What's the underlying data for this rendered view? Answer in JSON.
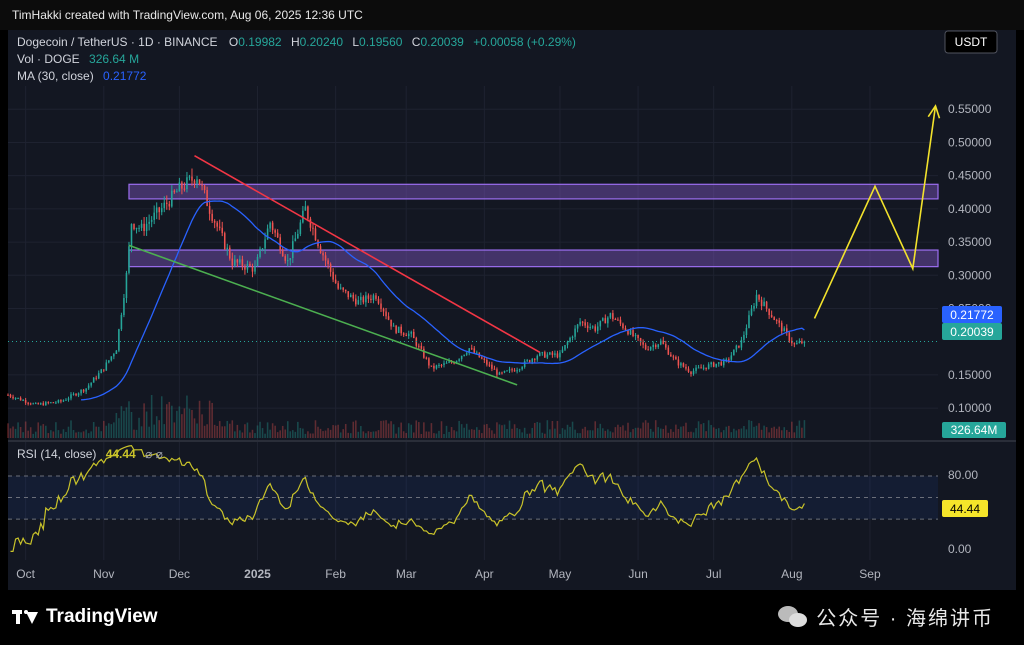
{
  "header": {
    "credit": "TimHakki created with TradingView.com, Aug 06, 2025 12:36 UTC"
  },
  "legend": {
    "symbol": "Dogecoin / TetherUS · 1D · BINANCE",
    "o_label": "O",
    "o": "0.19982",
    "h_label": "H",
    "h": "0.20240",
    "l_label": "L",
    "l": "0.19560",
    "c_label": "C",
    "c": "0.20039",
    "change": "+0.00058 (+0.29%)",
    "vol_label": "Vol · DOGE",
    "vol": "326.64 M",
    "ma_label": "MA (30, close)",
    "ma": "0.21772"
  },
  "currency_button": "USDT",
  "price_badges": {
    "ma": "0.21772",
    "last": "0.20039",
    "volume": "326.64M",
    "rsi": "44.44"
  },
  "rsi": {
    "label": "RSI (14, close)",
    "value": "44.44",
    "icons": "⌀ ⌀",
    "ticks": [
      "80.00",
      "0.00"
    ]
  },
  "footer": {
    "brand": "TradingView",
    "watermark": "公众号 · 海绵讲币"
  },
  "colors": {
    "up": "#26a69a",
    "down": "#ef5350",
    "ma": "#2962ff",
    "rsi": "#c9c32a",
    "zone": "#7e57c2",
    "projection": "#f2e22c",
    "resistance": "#f23645",
    "support": "#4caf50"
  },
  "chart_data": {
    "type": "candlestick",
    "title": "Dogecoin / TetherUS · 1D · BINANCE",
    "y_ticks": [
      "0.55000",
      "0.50000",
      "0.45000",
      "0.40000",
      "0.35000",
      "0.30000",
      "0.25000",
      "0.15000",
      "0.10000"
    ],
    "y_tick_values": [
      0.55,
      0.5,
      0.45,
      0.4,
      0.35,
      0.3,
      0.25,
      0.15,
      0.1
    ],
    "ylim": [
      0.055,
      0.585
    ],
    "x_ticks": [
      "Oct",
      "Nov",
      "Dec",
      "2025",
      "Feb",
      "Mar",
      "Apr",
      "May",
      "Jun",
      "Jul",
      "Aug",
      "Sep"
    ],
    "x_tick_dates": [
      "2024-10-01",
      "2024-11-01",
      "2024-12-01",
      "2025-01-01",
      "2025-02-01",
      "2025-03-01",
      "2025-04-01",
      "2025-05-01",
      "2025-06-01",
      "2025-07-01",
      "2025-08-01",
      "2025-09-01"
    ],
    "xlim": [
      "2024-09-24",
      "2025-09-28"
    ],
    "price_anchors": [
      [
        "2024-09-24",
        0.12
      ],
      [
        "2024-10-05",
        0.105
      ],
      [
        "2024-10-15",
        0.11
      ],
      [
        "2024-10-25",
        0.13
      ],
      [
        "2024-11-01",
        0.16
      ],
      [
        "2024-11-06",
        0.19
      ],
      [
        "2024-11-10",
        0.3
      ],
      [
        "2024-11-12",
        0.38
      ],
      [
        "2024-11-16",
        0.37
      ],
      [
        "2024-11-24",
        0.4
      ],
      [
        "2024-12-01",
        0.43
      ],
      [
        "2024-12-08",
        0.45
      ],
      [
        "2024-12-13",
        0.4
      ],
      [
        "2024-12-22",
        0.32
      ],
      [
        "2024-12-31",
        0.31
      ],
      [
        "2025-01-06",
        0.38
      ],
      [
        "2025-01-13",
        0.32
      ],
      [
        "2025-01-20",
        0.4
      ],
      [
        "2025-01-26",
        0.34
      ],
      [
        "2025-02-02",
        0.28
      ],
      [
        "2025-02-10",
        0.26
      ],
      [
        "2025-02-17",
        0.27
      ],
      [
        "2025-02-24",
        0.22
      ],
      [
        "2025-03-03",
        0.21
      ],
      [
        "2025-03-11",
        0.16
      ],
      [
        "2025-03-20",
        0.17
      ],
      [
        "2025-03-26",
        0.19
      ],
      [
        "2025-04-01",
        0.17
      ],
      [
        "2025-04-07",
        0.15
      ],
      [
        "2025-04-14",
        0.16
      ],
      [
        "2025-04-22",
        0.18
      ],
      [
        "2025-05-01",
        0.18
      ],
      [
        "2025-05-09",
        0.23
      ],
      [
        "2025-05-15",
        0.22
      ],
      [
        "2025-05-21",
        0.24
      ],
      [
        "2025-05-27",
        0.22
      ],
      [
        "2025-06-04",
        0.19
      ],
      [
        "2025-06-10",
        0.2
      ],
      [
        "2025-06-16",
        0.17
      ],
      [
        "2025-06-22",
        0.155
      ],
      [
        "2025-06-30",
        0.165
      ],
      [
        "2025-07-06",
        0.17
      ],
      [
        "2025-07-12",
        0.2
      ],
      [
        "2025-07-18",
        0.27
      ],
      [
        "2025-07-22",
        0.25
      ],
      [
        "2025-07-28",
        0.22
      ],
      [
        "2025-08-02",
        0.195
      ],
      [
        "2025-08-06",
        0.20039
      ]
    ],
    "ma": {
      "name": "MA (30, close)",
      "last": 0.21772
    },
    "last_price": 0.20039,
    "zones": [
      {
        "from": 0.415,
        "to": 0.437,
        "start": "2024-11-11"
      },
      {
        "from": 0.313,
        "to": 0.338,
        "start": "2024-11-11"
      }
    ],
    "trendlines": [
      {
        "role": "resistance",
        "from": [
          "2024-12-07",
          0.48
        ],
        "to": [
          "2025-04-23",
          0.184
        ]
      },
      {
        "role": "support",
        "from": [
          "2024-11-11",
          0.345
        ],
        "to": [
          "2025-04-14",
          0.135
        ]
      }
    ],
    "projection": [
      [
        "2025-08-10",
        0.235
      ],
      [
        "2025-09-03",
        0.434
      ],
      [
        "2025-09-18",
        0.31
      ],
      [
        "2025-09-27",
        0.555
      ]
    ],
    "rsi": {
      "name": "RSI (14, close)",
      "last": 44.44,
      "bands": [
        70,
        50,
        30
      ],
      "ylim": [
        -8,
        96
      ],
      "ticks": [
        80,
        0
      ]
    }
  }
}
